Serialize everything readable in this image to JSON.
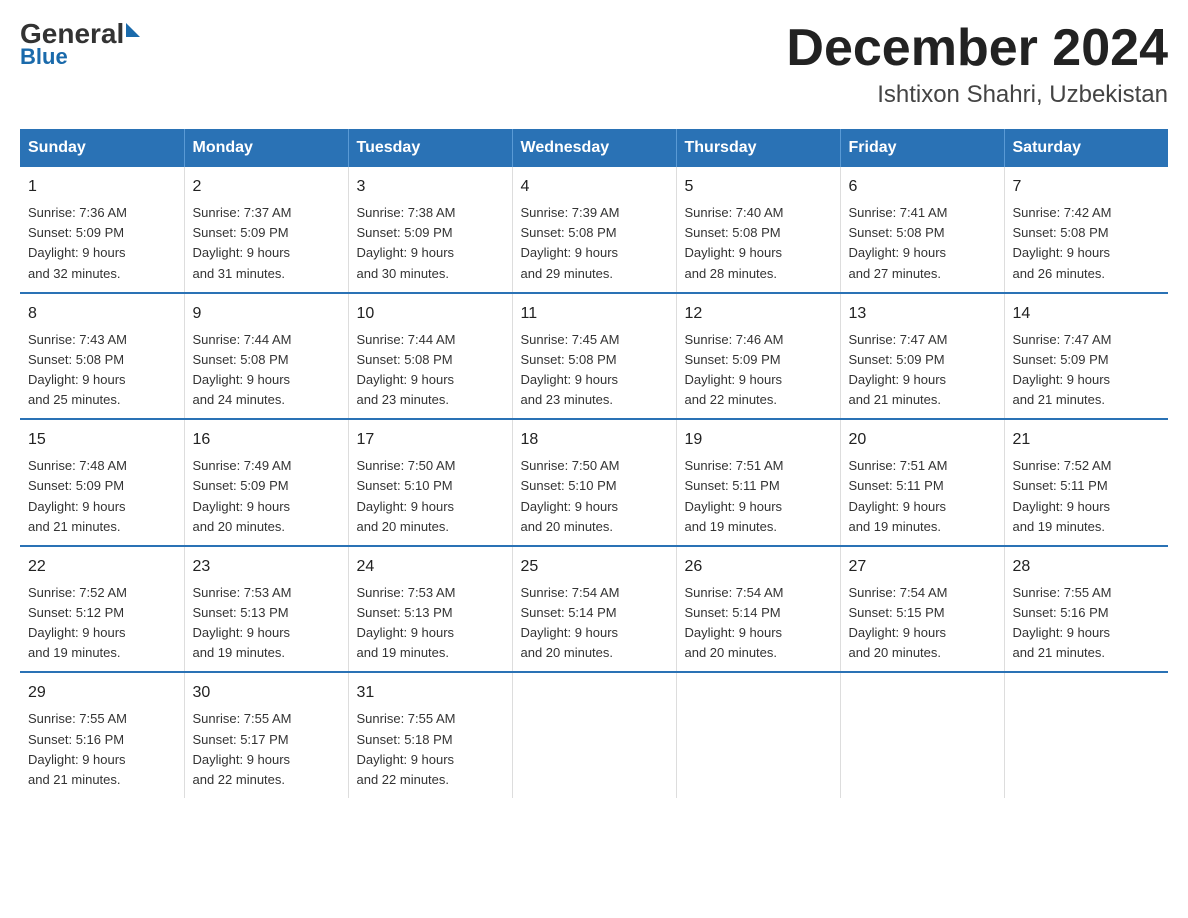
{
  "header": {
    "logo_general": "General",
    "logo_blue": "Blue",
    "title": "December 2024",
    "subtitle": "Ishtixon Shahri, Uzbekistan"
  },
  "weekdays": [
    "Sunday",
    "Monday",
    "Tuesday",
    "Wednesday",
    "Thursday",
    "Friday",
    "Saturday"
  ],
  "weeks": [
    [
      {
        "day": "1",
        "info": "Sunrise: 7:36 AM\nSunset: 5:09 PM\nDaylight: 9 hours\nand 32 minutes."
      },
      {
        "day": "2",
        "info": "Sunrise: 7:37 AM\nSunset: 5:09 PM\nDaylight: 9 hours\nand 31 minutes."
      },
      {
        "day": "3",
        "info": "Sunrise: 7:38 AM\nSunset: 5:09 PM\nDaylight: 9 hours\nand 30 minutes."
      },
      {
        "day": "4",
        "info": "Sunrise: 7:39 AM\nSunset: 5:08 PM\nDaylight: 9 hours\nand 29 minutes."
      },
      {
        "day": "5",
        "info": "Sunrise: 7:40 AM\nSunset: 5:08 PM\nDaylight: 9 hours\nand 28 minutes."
      },
      {
        "day": "6",
        "info": "Sunrise: 7:41 AM\nSunset: 5:08 PM\nDaylight: 9 hours\nand 27 minutes."
      },
      {
        "day": "7",
        "info": "Sunrise: 7:42 AM\nSunset: 5:08 PM\nDaylight: 9 hours\nand 26 minutes."
      }
    ],
    [
      {
        "day": "8",
        "info": "Sunrise: 7:43 AM\nSunset: 5:08 PM\nDaylight: 9 hours\nand 25 minutes."
      },
      {
        "day": "9",
        "info": "Sunrise: 7:44 AM\nSunset: 5:08 PM\nDaylight: 9 hours\nand 24 minutes."
      },
      {
        "day": "10",
        "info": "Sunrise: 7:44 AM\nSunset: 5:08 PM\nDaylight: 9 hours\nand 23 minutes."
      },
      {
        "day": "11",
        "info": "Sunrise: 7:45 AM\nSunset: 5:08 PM\nDaylight: 9 hours\nand 23 minutes."
      },
      {
        "day": "12",
        "info": "Sunrise: 7:46 AM\nSunset: 5:09 PM\nDaylight: 9 hours\nand 22 minutes."
      },
      {
        "day": "13",
        "info": "Sunrise: 7:47 AM\nSunset: 5:09 PM\nDaylight: 9 hours\nand 21 minutes."
      },
      {
        "day": "14",
        "info": "Sunrise: 7:47 AM\nSunset: 5:09 PM\nDaylight: 9 hours\nand 21 minutes."
      }
    ],
    [
      {
        "day": "15",
        "info": "Sunrise: 7:48 AM\nSunset: 5:09 PM\nDaylight: 9 hours\nand 21 minutes."
      },
      {
        "day": "16",
        "info": "Sunrise: 7:49 AM\nSunset: 5:09 PM\nDaylight: 9 hours\nand 20 minutes."
      },
      {
        "day": "17",
        "info": "Sunrise: 7:50 AM\nSunset: 5:10 PM\nDaylight: 9 hours\nand 20 minutes."
      },
      {
        "day": "18",
        "info": "Sunrise: 7:50 AM\nSunset: 5:10 PM\nDaylight: 9 hours\nand 20 minutes."
      },
      {
        "day": "19",
        "info": "Sunrise: 7:51 AM\nSunset: 5:11 PM\nDaylight: 9 hours\nand 19 minutes."
      },
      {
        "day": "20",
        "info": "Sunrise: 7:51 AM\nSunset: 5:11 PM\nDaylight: 9 hours\nand 19 minutes."
      },
      {
        "day": "21",
        "info": "Sunrise: 7:52 AM\nSunset: 5:11 PM\nDaylight: 9 hours\nand 19 minutes."
      }
    ],
    [
      {
        "day": "22",
        "info": "Sunrise: 7:52 AM\nSunset: 5:12 PM\nDaylight: 9 hours\nand 19 minutes."
      },
      {
        "day": "23",
        "info": "Sunrise: 7:53 AM\nSunset: 5:13 PM\nDaylight: 9 hours\nand 19 minutes."
      },
      {
        "day": "24",
        "info": "Sunrise: 7:53 AM\nSunset: 5:13 PM\nDaylight: 9 hours\nand 19 minutes."
      },
      {
        "day": "25",
        "info": "Sunrise: 7:54 AM\nSunset: 5:14 PM\nDaylight: 9 hours\nand 20 minutes."
      },
      {
        "day": "26",
        "info": "Sunrise: 7:54 AM\nSunset: 5:14 PM\nDaylight: 9 hours\nand 20 minutes."
      },
      {
        "day": "27",
        "info": "Sunrise: 7:54 AM\nSunset: 5:15 PM\nDaylight: 9 hours\nand 20 minutes."
      },
      {
        "day": "28",
        "info": "Sunrise: 7:55 AM\nSunset: 5:16 PM\nDaylight: 9 hours\nand 21 minutes."
      }
    ],
    [
      {
        "day": "29",
        "info": "Sunrise: 7:55 AM\nSunset: 5:16 PM\nDaylight: 9 hours\nand 21 minutes."
      },
      {
        "day": "30",
        "info": "Sunrise: 7:55 AM\nSunset: 5:17 PM\nDaylight: 9 hours\nand 22 minutes."
      },
      {
        "day": "31",
        "info": "Sunrise: 7:55 AM\nSunset: 5:18 PM\nDaylight: 9 hours\nand 22 minutes."
      },
      {
        "day": "",
        "info": ""
      },
      {
        "day": "",
        "info": ""
      },
      {
        "day": "",
        "info": ""
      },
      {
        "day": "",
        "info": ""
      }
    ]
  ]
}
